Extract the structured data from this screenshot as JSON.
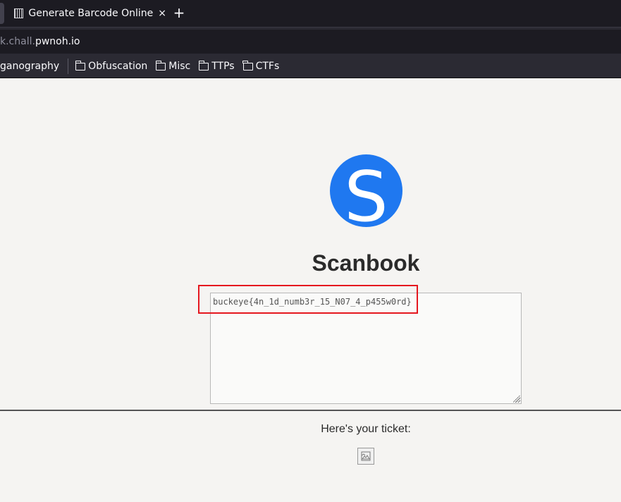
{
  "browser": {
    "tab": {
      "title": "Generate Barcode Online",
      "close_glyph": "×",
      "favicon": "barcode-icon"
    },
    "new_tab_glyph": "+",
    "url": {
      "prefix": "k.chall.",
      "host": "pwnoh.io"
    },
    "bookmarks": [
      {
        "label": "ganography",
        "icon": ""
      },
      {
        "label": "Obfuscation",
        "icon": "folder-icon"
      },
      {
        "label": "Misc",
        "icon": "folder-icon"
      },
      {
        "label": "TTPs",
        "icon": "folder-icon"
      },
      {
        "label": "CTFs",
        "icon": "folder-icon"
      }
    ]
  },
  "page": {
    "logo_letter": "S",
    "logo_color": "#1f78f0",
    "title": "Scanbook",
    "textarea_value": "buckeye{4n_1d_numb3r_15_N07_4_p455w0rd}",
    "ticket_label": "Here's your ticket:",
    "highlight_color": "#e5171f"
  }
}
